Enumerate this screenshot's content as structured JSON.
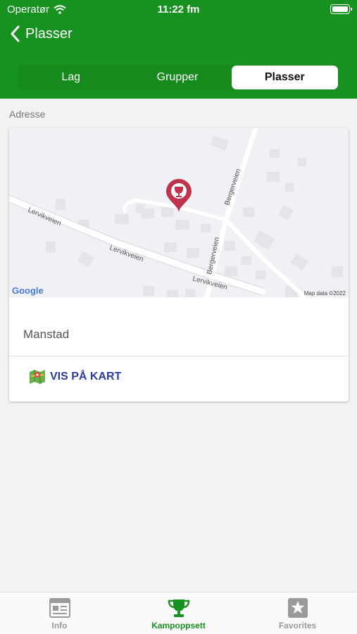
{
  "status_bar": {
    "carrier": "Operatør",
    "time": "11:22 fm"
  },
  "nav": {
    "title": "Plasser"
  },
  "segments": [
    {
      "label": "Lag"
    },
    {
      "label": "Grupper"
    },
    {
      "label": "Plasser"
    }
  ],
  "section": {
    "label": "Adresse"
  },
  "map": {
    "roads": [
      "Lervikveien",
      "Lervikveien",
      "Lervikveien",
      "Bergerveien",
      "Bergerveien"
    ],
    "google_logo": "Google",
    "attribution": "Map data ©2022",
    "pin_icon": "trophy-pin-icon"
  },
  "location": {
    "address": "Manstad",
    "map_button_label": "VIS PÅ KART",
    "map_button_icon": "map-icon"
  },
  "tabs": [
    {
      "label": "Info",
      "icon": "newspaper-icon"
    },
    {
      "label": "Kampoppsett",
      "icon": "trophy-icon"
    },
    {
      "label": "Favorites",
      "icon": "star-icon"
    }
  ],
  "colors": {
    "brand_green": "#17911f",
    "link_blue": "#2e3c9e",
    "pin_red": "#c0334d"
  }
}
